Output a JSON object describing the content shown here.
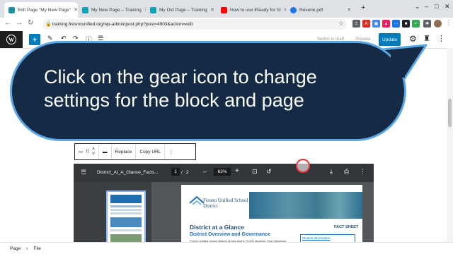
{
  "browser": {
    "tabs": [
      {
        "label": "Edit Page \"My New Page\"",
        "color": "#1e8e9e"
      },
      {
        "label": "My New Page – Training",
        "color": "#17a2b8"
      },
      {
        "label": "My Old Page – Training",
        "color": "#17a2b8"
      },
      {
        "label": "How to use iReady for SI",
        "color": "#ff0000"
      },
      {
        "label": "Reverie.pdf",
        "color": "#1a73e8"
      }
    ],
    "new_tab": "+",
    "url": "training.fresnounified.org/wp-admin/post.php?post=4903&action=edit"
  },
  "wp": {
    "logo": "W",
    "add": "+",
    "switch_draft": "Switch to draft",
    "preview": "Preview",
    "update": "Update"
  },
  "bubble": {
    "line1": "Click on the gear icon to change",
    "line2": "settings for the block and page"
  },
  "block_toolbar": {
    "replace": "Replace",
    "copy_url": "Copy URL"
  },
  "pdf": {
    "filename": "District_At_A_Glance_Facts...",
    "page_current": "1",
    "page_sep": "/",
    "page_total": "2",
    "zoom": "63%",
    "org_name": "Fresno Unified School District",
    "heading": "District at a Glance",
    "fact_sheet": "FACT SHEET",
    "subheading": "District Overview and Governance",
    "body": "Fresno Unified School District serves nearly 74,000 students, from preschool through grade 12, teaching students achieve their potential for college...",
    "link": "Student information"
  },
  "footer": {
    "page": "Page",
    "sep": "›",
    "file": "File"
  }
}
